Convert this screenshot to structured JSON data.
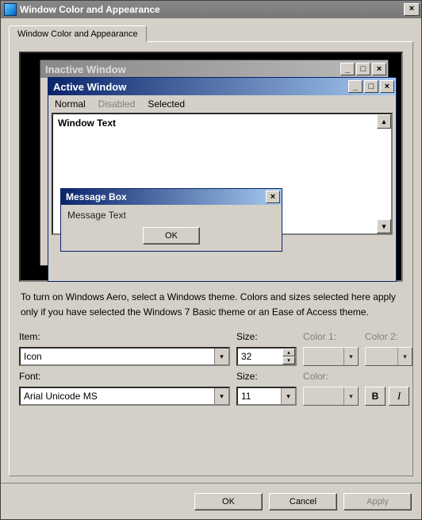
{
  "dialog": {
    "title": "Window Color and Appearance",
    "close_glyph": "×"
  },
  "tab": {
    "label": "Window Color and Appearance"
  },
  "preview": {
    "inactive_title": "Inactive Window",
    "active_title": "Active Window",
    "menu": {
      "normal": "Normal",
      "disabled": "Disabled",
      "selected": "Selected"
    },
    "window_text": "Window Text",
    "msgbox_title": "Message Box",
    "msgbox_text": "Message Text",
    "msgbox_ok": "OK",
    "minimize_glyph": "_",
    "maximize_glyph": "□",
    "close_glyph": "×",
    "up_glyph": "▴",
    "down_glyph": "▾"
  },
  "description": "To turn on Windows Aero, select a Windows theme.  Colors and sizes selected here apply only if you have selected the Windows 7 Basic theme or an Ease of Access theme.",
  "labels": {
    "item": "Item:",
    "size": "Size:",
    "color1": "Color 1:",
    "color2": "Color 2:",
    "font": "Font:",
    "fsize": "Size:",
    "fcolor": "Color:"
  },
  "item": {
    "value": "Icon",
    "size": "32"
  },
  "font": {
    "value": "Arial Unicode MS",
    "size": "11"
  },
  "glyphs": {
    "dd": "▾",
    "up": "▴",
    "dn": "▾",
    "bold": "B",
    "italic": "I"
  },
  "footer": {
    "ok": "OK",
    "cancel": "Cancel",
    "apply": "Apply"
  }
}
